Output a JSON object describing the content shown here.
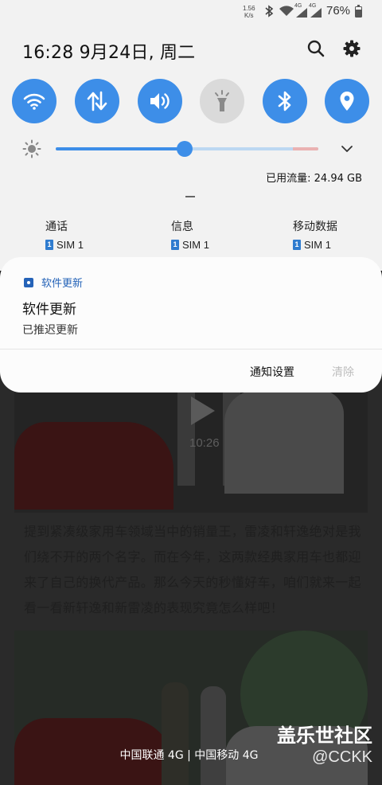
{
  "status_bar": {
    "net_speed_value": "1.56",
    "net_speed_unit": "K/s",
    "battery_percent": "76%",
    "battery_level": 0.76,
    "signal_label_1": "4G",
    "signal_label_2": "4G"
  },
  "header": {
    "clock": "16:28  9月24日, 周二",
    "search_icon": "search-icon",
    "settings_icon": "gear-icon"
  },
  "quick_toggles": [
    {
      "name": "wifi",
      "icon": "wifi-icon",
      "active": true
    },
    {
      "name": "mobile-data",
      "icon": "data-arrows-icon",
      "active": true
    },
    {
      "name": "sound",
      "icon": "volume-icon",
      "active": true
    },
    {
      "name": "flashlight",
      "icon": "flashlight-icon",
      "active": false
    },
    {
      "name": "bluetooth",
      "icon": "bluetooth-icon",
      "active": true
    },
    {
      "name": "location",
      "icon": "location-icon",
      "active": true
    }
  ],
  "brightness": {
    "level": 0.49,
    "accent_color": "#3d8ee8"
  },
  "data_usage": "已用流量: 24.94 GB",
  "sim_settings": [
    {
      "title": "通话",
      "badge": "1",
      "value": "SIM 1"
    },
    {
      "title": "信息",
      "badge": "1",
      "value": "SIM 1"
    },
    {
      "title": "移动数据",
      "badge": "1",
      "value": "SIM 1"
    }
  ],
  "notification": {
    "app_name": "软件更新",
    "title": "软件更新",
    "text": "已推迟更新",
    "settings_button": "通知设置",
    "clear_button": "清除"
  },
  "background_article": {
    "video_duration": "10:26",
    "paragraph": "提到紧凑级家用车领域当中的销量王，雷凌和轩逸绝对是我们绕不开的两个名字。而在今年，这两款经典家用车也都迎来了自己的换代产品。那么今天的秒懂好车，咱们就来一起看一看新轩逸和新雷凌的表现究竟怎么样吧！"
  },
  "carrier": "中国联通 4G | 中国移动 4G",
  "watermark": {
    "title": "盖乐世社区",
    "subtitle": "@CCKK"
  }
}
